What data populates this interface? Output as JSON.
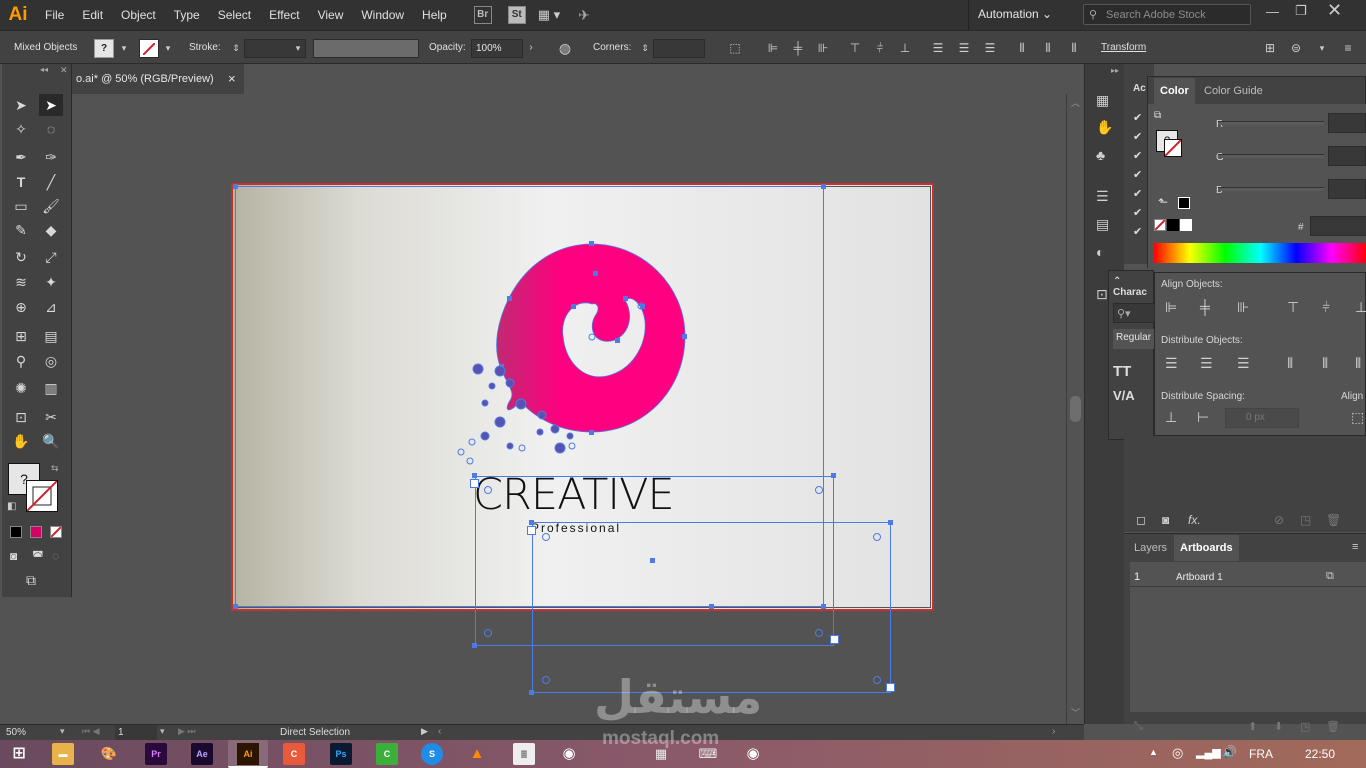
{
  "app": {
    "logo": "Ai",
    "menu": [
      "File",
      "Edit",
      "Object",
      "Type",
      "Select",
      "Effect",
      "View",
      "Window",
      "Help"
    ],
    "bridge_label": "Br",
    "stock_label": "St",
    "workspace": "Automation",
    "search_placeholder": "Search Adobe Stock",
    "accent": "#ff9a00"
  },
  "controlbar": {
    "selection_type": "Mixed Objects",
    "stroke_label": "Stroke:",
    "opacity_label": "Opacity:",
    "opacity_value": "100%",
    "corners_label": "Corners:",
    "transform_label": "Transform",
    "unknown_fill": "?"
  },
  "document": {
    "tab_title": "o.ai* @ 50% (RGB/Preview)",
    "close": "×"
  },
  "artwork": {
    "logo_color": "#ff0080",
    "headline": "CREATIVE",
    "subline": "Professional"
  },
  "color_panel": {
    "tab_active": "Color",
    "tab_other": "Color Guide",
    "channels": [
      "R",
      "G",
      "B"
    ],
    "hex_label": "#",
    "unknown": "?"
  },
  "align_panel": {
    "align_objects": "Align Objects:",
    "distribute_objects": "Distribute Objects:",
    "distribute_spacing": "Distribute Spacing:",
    "align_to": "Align",
    "spacing_value": "0 px"
  },
  "character_panel": {
    "tab": "Charac",
    "style": "Regular"
  },
  "actions_panel_tab": "Ac",
  "layers_panel": {
    "tab_layers": "Layers",
    "tab_artboards": "Artboards",
    "rows": [
      {
        "index": "1",
        "name": "Artboard 1"
      }
    ]
  },
  "statusbar": {
    "zoom": "50%",
    "page": "1",
    "tool": "Direct Selection"
  },
  "taskbar": {
    "language": "FRA",
    "time": "22:50",
    "watermark_ar": "مستقل",
    "watermark_en": "mostaql.com",
    "apps": [
      "Pr",
      "Ae",
      "Ai",
      "C",
      "Ps",
      "C",
      "S"
    ]
  }
}
